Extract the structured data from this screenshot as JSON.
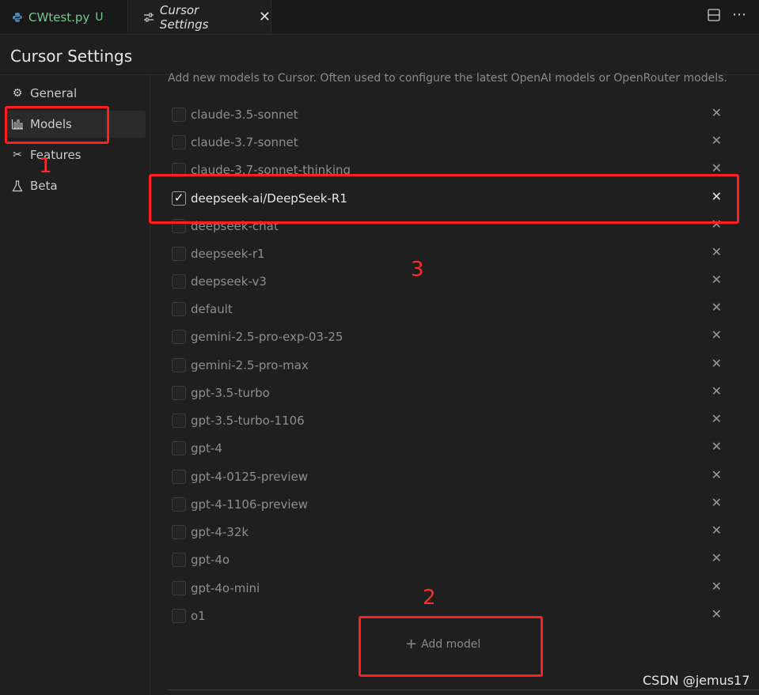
{
  "tabs": [
    {
      "label": "CWtest.py",
      "status": "U",
      "icon": "python-icon"
    },
    {
      "label": "Cursor Settings",
      "icon": "settings-sliders-icon"
    }
  ],
  "settings_title": "Cursor Settings",
  "sidebar": {
    "items": [
      {
        "label": "General",
        "icon": "gear-icon"
      },
      {
        "label": "Models",
        "icon": "bar-chart-icon"
      },
      {
        "label": "Features",
        "icon": "tools-icon"
      },
      {
        "label": "Beta",
        "icon": "flask-icon"
      }
    ]
  },
  "main": {
    "description": "Add new models to Cursor. Often used to configure the latest OpenAI models or OpenRouter models.",
    "models": [
      {
        "name": "claude-3.5-sonnet",
        "checked": false
      },
      {
        "name": "claude-3.7-sonnet",
        "checked": false
      },
      {
        "name": "claude-3.7-sonnet-thinking",
        "checked": false
      },
      {
        "name": "deepseek-ai/DeepSeek-R1",
        "checked": true
      },
      {
        "name": "deepseek-chat",
        "checked": false
      },
      {
        "name": "deepseek-r1",
        "checked": false
      },
      {
        "name": "deepseek-v3",
        "checked": false
      },
      {
        "name": "default",
        "checked": false
      },
      {
        "name": "gemini-2.5-pro-exp-03-25",
        "checked": false
      },
      {
        "name": "gemini-2.5-pro-max",
        "checked": false
      },
      {
        "name": "gpt-3.5-turbo",
        "checked": false
      },
      {
        "name": "gpt-3.5-turbo-1106",
        "checked": false
      },
      {
        "name": "gpt-4",
        "checked": false
      },
      {
        "name": "gpt-4-0125-preview",
        "checked": false
      },
      {
        "name": "gpt-4-1106-preview",
        "checked": false
      },
      {
        "name": "gpt-4-32k",
        "checked": false
      },
      {
        "name": "gpt-4o",
        "checked": false
      },
      {
        "name": "gpt-4o-mini",
        "checked": false
      },
      {
        "name": "o1",
        "checked": false
      }
    ],
    "add_model_label": "Add model"
  },
  "annotations": {
    "label1": "1",
    "label2": "2",
    "label3": "3"
  },
  "watermark": "CSDN @jemus17",
  "colors": {
    "annotation": "#ff1f1f",
    "modified": "#73c991",
    "background": "#1f1f1f"
  }
}
